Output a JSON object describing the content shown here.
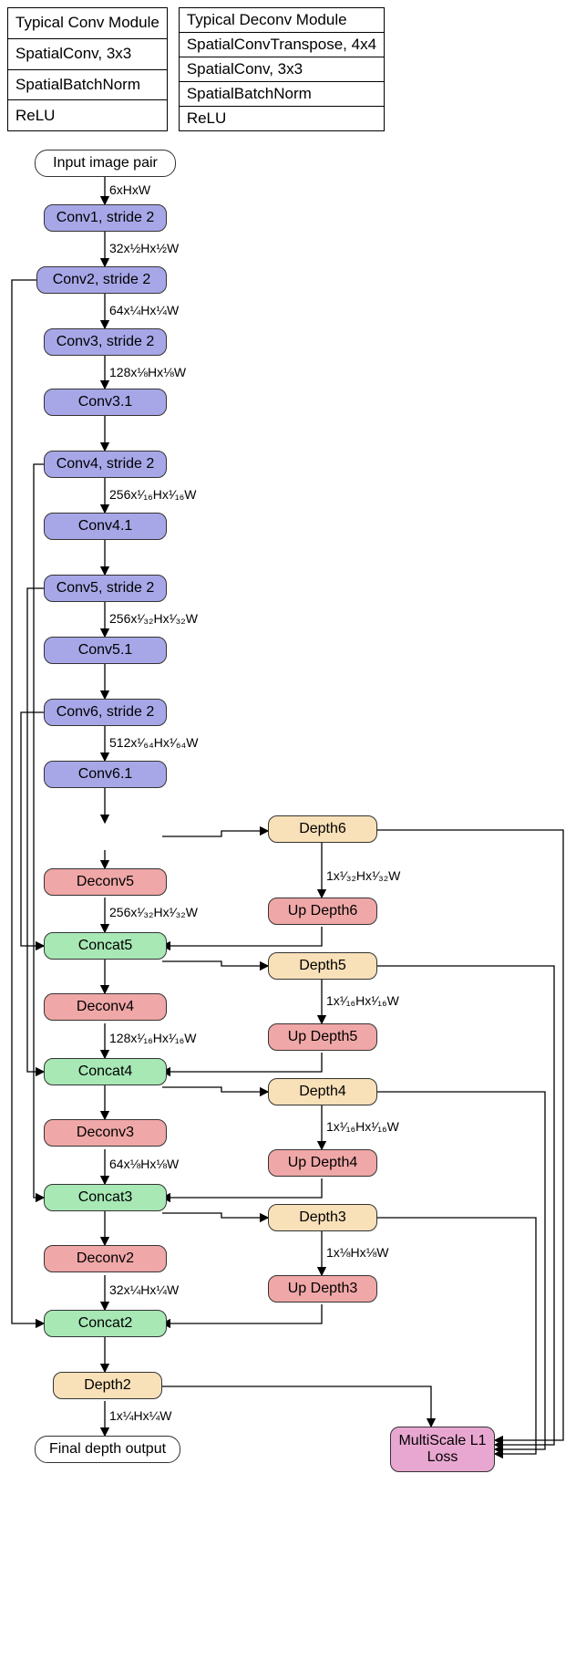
{
  "conv_module": {
    "title": "Typical Conv Module",
    "rows": [
      "SpatialConv, 3x3",
      "SpatialBatchNorm",
      "ReLU"
    ]
  },
  "deconv_module": {
    "title": "Typical Deconv Module",
    "rows": [
      "SpatialConvTranspose, 4x4",
      "SpatialConv, 3x3",
      "SpatialBatchNorm",
      "ReLU"
    ]
  },
  "nodes": {
    "input": "Input image pair",
    "conv1": "Conv1, stride 2",
    "conv2": "Conv2, stride 2",
    "conv3": "Conv3, stride 2",
    "conv31": "Conv3.1",
    "conv4": "Conv4, stride 2",
    "conv41": "Conv4.1",
    "conv5": "Conv5, stride 2",
    "conv51": "Conv5.1",
    "conv6": "Conv6, stride 2",
    "conv61": "Conv6.1",
    "depth6": "Depth6",
    "updepth6": "Up Depth6",
    "deconv5": "Deconv5",
    "concat5": "Concat5",
    "depth5": "Depth5",
    "updepth5": "Up Depth5",
    "deconv4": "Deconv4",
    "concat4": "Concat4",
    "depth4": "Depth4",
    "updepth4": "Up Depth4",
    "deconv3": "Deconv3",
    "concat3": "Concat3",
    "depth3": "Depth3",
    "updepth3": "Up Depth3",
    "deconv2": "Deconv2",
    "concat2": "Concat2",
    "depth2": "Depth2",
    "final": "Final depth output",
    "loss": "MultiScale L1 Loss"
  },
  "labels": {
    "l_in": "6xHxW",
    "l_c1": "32x½Hx½W",
    "l_c2": "64x¼Hx¼W",
    "l_c3": "128x⅛Hx⅛W",
    "l_c4": "256x¹⁄₁₆Hx¹⁄₁₆W",
    "l_c5": "256x¹⁄₃₂Hx¹⁄₃₂W",
    "l_c6": "512x¹⁄₆₄Hx¹⁄₆₄W",
    "l_d5": "256x¹⁄₃₂Hx¹⁄₃₂W",
    "l_ud6": "1x¹⁄₃₂Hx¹⁄₃₂W",
    "l_d4": "128x¹⁄₁₆Hx¹⁄₁₆W",
    "l_ud5": "1x¹⁄₁₆Hx¹⁄₁₆W",
    "l_d3": "64x⅛Hx⅛W",
    "l_ud4": "1x¹⁄₁₆Hx¹⁄₁₆W",
    "l_d2": "32x¼Hx¼W",
    "l_ud3": "1x⅛Hx⅛W",
    "l_depth2": "1x¼Hx¼W"
  }
}
